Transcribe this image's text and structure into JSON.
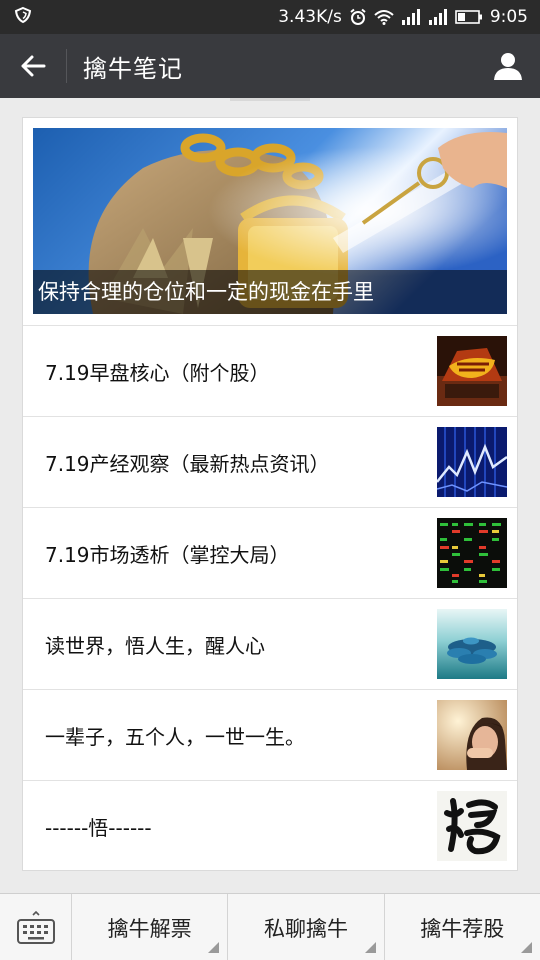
{
  "status_bar": {
    "speed": "3.43K/s",
    "time": "9:05"
  },
  "header": {
    "title": "擒牛笔记"
  },
  "feature": {
    "caption": "保持合理的仓位和一定的现金在手里"
  },
  "articles": [
    {
      "title": "7.19早盘核心（附个股）"
    },
    {
      "title": "7.19产经观察（最新热点资讯）"
    },
    {
      "title": "7.19市场透析（掌控大局）"
    },
    {
      "title": "读世界，悟人生，醒人心"
    },
    {
      "title": "一辈子，五个人，一世一生。"
    },
    {
      "title": "------悟------"
    }
  ],
  "bottom_menu": {
    "items": [
      {
        "label": "擒牛解票"
      },
      {
        "label": "私聊擒牛"
      },
      {
        "label": "擒牛荐股"
      }
    ]
  },
  "colors": {
    "status_bar": "#2b2b2b",
    "header": "#393a3e",
    "background": "#ebebeb"
  }
}
